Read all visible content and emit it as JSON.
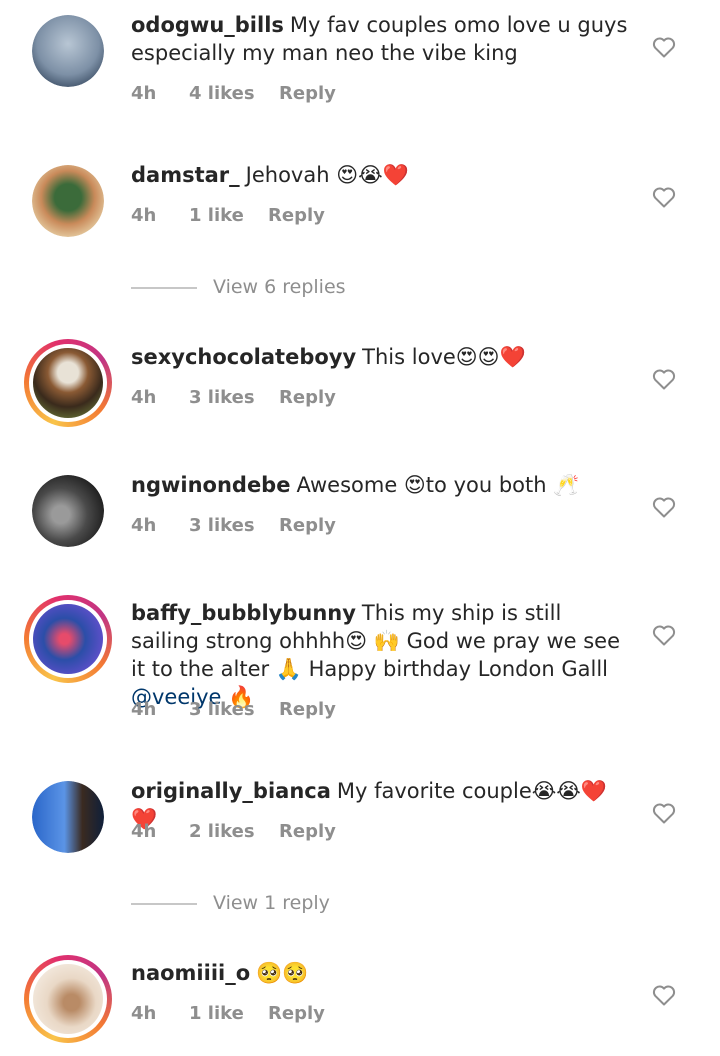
{
  "comments": [
    {
      "username": "odogwu_bills",
      "text": "My fav couples omo love u guys especially my man neo the vibe king",
      "time": "4h",
      "likes": "4 likes",
      "reply": "Reply",
      "avatar_colors": [
        "#8fa3b8",
        "#2c3e55"
      ]
    },
    {
      "username": "damstar_",
      "text": "Jehovah 😍😭❤️",
      "time": "4h",
      "likes": "1 like",
      "reply": "Reply",
      "avatar_colors": [
        "#c98a5a",
        "#3b6b3a"
      ]
    },
    {
      "username": "sexychocolateboyy",
      "text": "This love😍😍❤️",
      "time": "4h",
      "likes": "3 likes",
      "reply": "Reply",
      "avatar_colors": [
        "#d8c7a8",
        "#3a2a1c"
      ]
    },
    {
      "username": "ngwinondebe",
      "text": "Awesome 😍to you both 🥂",
      "time": "4h",
      "likes": "3 likes",
      "reply": "Reply",
      "avatar_colors": [
        "#6b6b6b",
        "#1a1a1a"
      ]
    },
    {
      "username": "baffy_bubblybunny",
      "text_parts": [
        "This my ship is still sailing strong ohhhh😍 🙌 God we pray we see it to the alter 🙏 Happy birthday London Galll ",
        "@veeiye",
        " 🔥"
      ],
      "time": "4h",
      "likes": "3 likes",
      "reply": "Reply",
      "avatar_colors": [
        "#5d4fc9",
        "#2b4ea8"
      ]
    },
    {
      "username": "originally_bianca",
      "text": "My favorite couple😭😭❤️❤️",
      "time": "4h",
      "likes": "2 likes",
      "reply": "Reply",
      "avatar_colors": [
        "#2a66c9",
        "#0f1f3a"
      ]
    },
    {
      "username": "naomiiii_o",
      "text": "🥺🥺",
      "time": "4h",
      "likes": "1 like",
      "reply": "Reply",
      "avatar_colors": [
        "#e9d8c6",
        "#b98b66"
      ]
    }
  ],
  "view_replies": [
    "View 6 replies",
    "View 1 reply"
  ]
}
